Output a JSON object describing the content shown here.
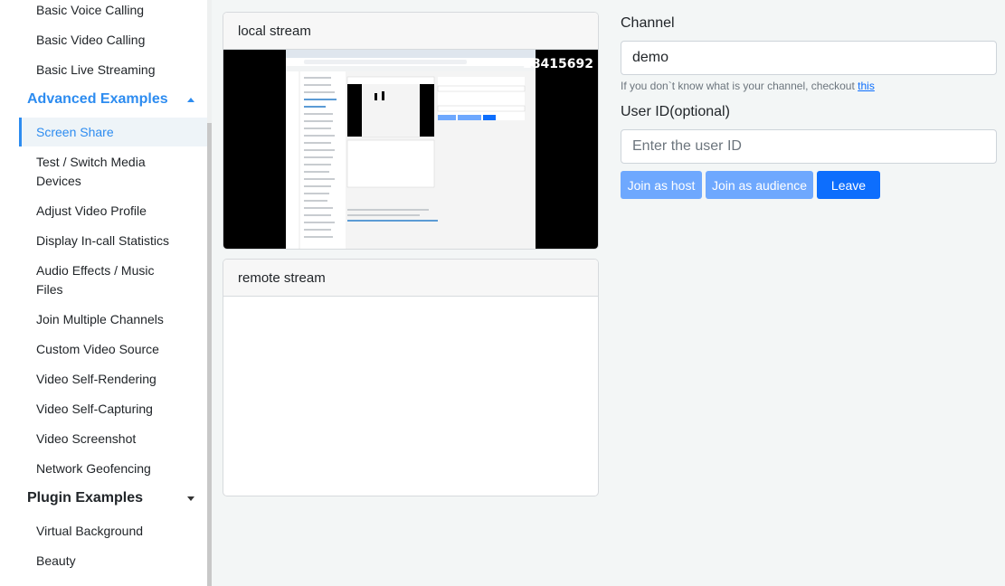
{
  "sidebar": {
    "items_top": [
      {
        "label": "Basic Voice Calling"
      },
      {
        "label": "Basic Video Calling"
      },
      {
        "label": "Basic Live Streaming"
      }
    ],
    "advanced_group": {
      "label": "Advanced Examples"
    },
    "advanced_items": [
      {
        "label": "Screen Share"
      },
      {
        "label": "Test / Switch Media Devices"
      },
      {
        "label": "Adjust Video Profile"
      },
      {
        "label": "Display In-call Statistics"
      },
      {
        "label": "Audio Effects / Music Files"
      },
      {
        "label": "Join Multiple Channels"
      },
      {
        "label": "Custom Video Source"
      },
      {
        "label": "Video Self-Rendering"
      },
      {
        "label": "Video Self-Capturing"
      },
      {
        "label": "Video Screenshot"
      },
      {
        "label": "Network Geofencing"
      }
    ],
    "plugin_group": {
      "label": "Plugin Examples"
    },
    "plugin_items": [
      {
        "label": "Virtual Background"
      },
      {
        "label": "Beauty"
      }
    ]
  },
  "local_stream": {
    "title": "local stream",
    "overlay_text": "28415692"
  },
  "remote_stream": {
    "title": "remote stream"
  },
  "form": {
    "channel_label": "Channel",
    "channel_value": "demo",
    "hint_text": "If you don`t know what is your channel, checkout ",
    "hint_link": "this",
    "uid_label": "User ID(optional)",
    "uid_placeholder": "Enter the user ID",
    "join_host": "Join as host",
    "join_audience": "Join as audience",
    "leave": "Leave"
  }
}
